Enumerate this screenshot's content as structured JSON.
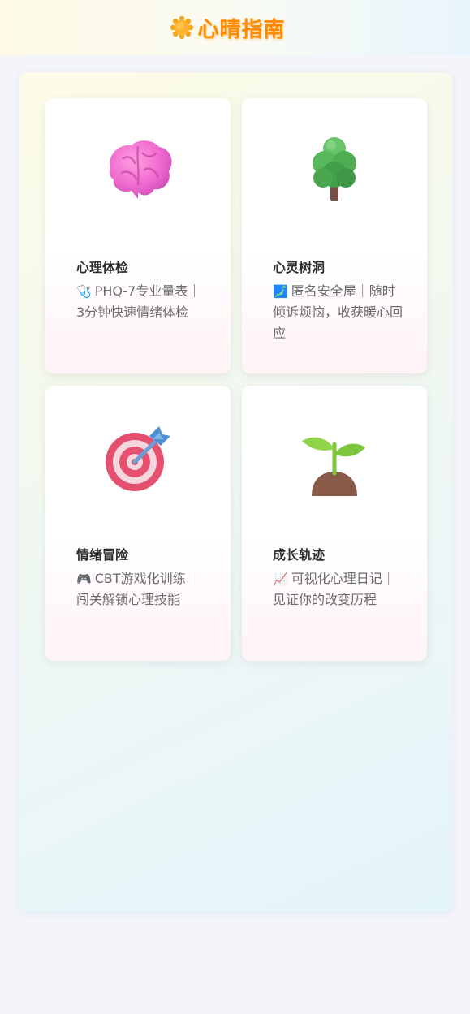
{
  "header": {
    "title": "心晴指南",
    "logo_icon": "sun-icon"
  },
  "cards": [
    {
      "title": "心理体检",
      "emoji": "🩺",
      "description": "PHQ-7专业量表｜3分钟快速情绪体检",
      "icon": "brain-icon"
    },
    {
      "title": "心灵树洞",
      "emoji": "🗾",
      "description": "匿名安全屋｜随时倾诉烦恼，收获暖心回应",
      "icon": "tree-icon"
    },
    {
      "title": "情绪冒险",
      "emoji": "🎮",
      "description": "CBT游戏化训练｜闯关解锁心理技能",
      "icon": "target-icon"
    },
    {
      "title": "成长轨迹",
      "emoji": "📈",
      "description": "可视化心理日记｜见证你的改变历程",
      "icon": "sprout-icon"
    }
  ],
  "colors": {
    "brand": "#ff8a00",
    "background": "#f3f5fa"
  }
}
